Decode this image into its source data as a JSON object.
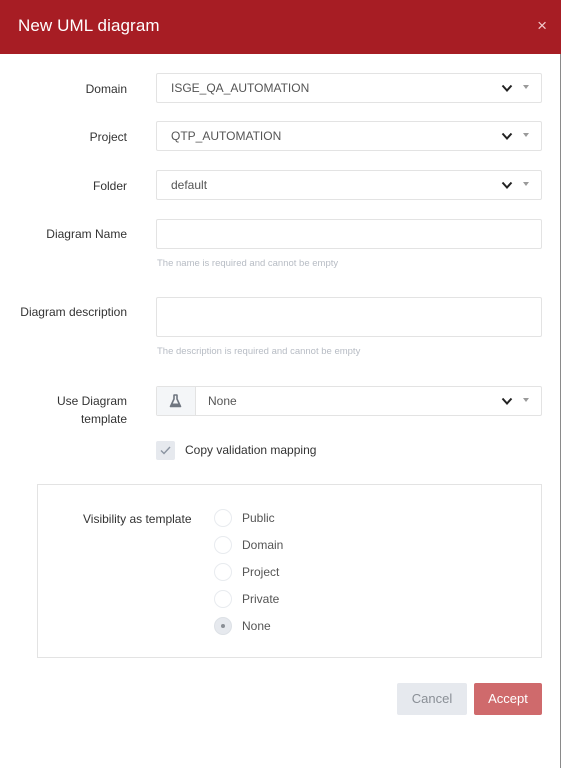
{
  "dialog": {
    "title": "New UML diagram",
    "close_symbol": "×"
  },
  "form": {
    "domain": {
      "label": "Domain",
      "value": "ISGE_QA_AUTOMATION"
    },
    "project": {
      "label": "Project",
      "value": "QTP_AUTOMATION"
    },
    "folder": {
      "label": "Folder",
      "value": "default"
    },
    "diagram_name": {
      "label": "Diagram Name",
      "value": "",
      "hint": "The name is required and cannot be empty"
    },
    "diagram_description": {
      "label": "Diagram description",
      "value": "",
      "hint": "The description is required and cannot be empty"
    },
    "template": {
      "label_line1": "Use Diagram",
      "label_line2": "template",
      "value": "None",
      "icon": "flask-icon"
    },
    "copy_validation": {
      "label": "Copy validation mapping",
      "checked": true
    }
  },
  "visibility": {
    "label": "Visibility as template",
    "options": [
      {
        "label": "Public",
        "checked": false
      },
      {
        "label": "Domain",
        "checked": false
      },
      {
        "label": "Project",
        "checked": false
      },
      {
        "label": "Private",
        "checked": false
      },
      {
        "label": "None",
        "checked": true
      }
    ]
  },
  "actions": {
    "cancel_label": "Cancel",
    "accept_label": "Accept"
  },
  "colors": {
    "header": "#a71d24",
    "accept": "#cf6a6c",
    "cancel": "#e6e9ee"
  }
}
